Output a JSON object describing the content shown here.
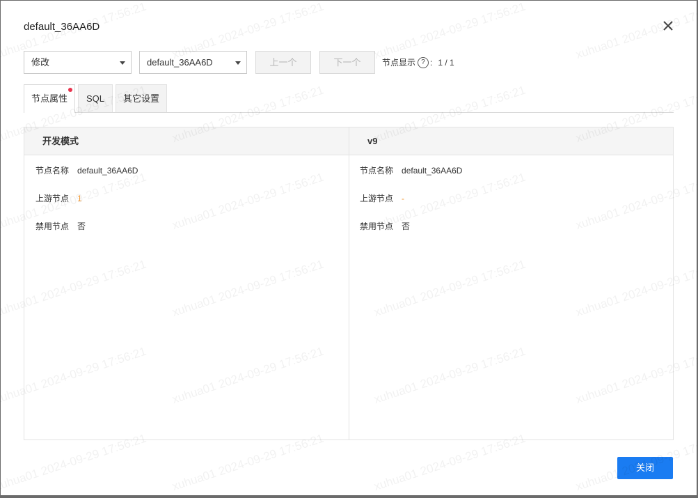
{
  "dialog": {
    "title": "default_36AA6D",
    "close_icon": "close-icon"
  },
  "toolbar": {
    "change_type_select": "修改",
    "node_select": "default_36AA6D",
    "prev_button": "上一个",
    "next_button": "下一个",
    "node_display_label": "节点显示",
    "help_icon": "question-circle-icon",
    "help_glyph": "?",
    "colon": ":",
    "node_count": "1 / 1"
  },
  "tabs": [
    {
      "label": "节点属性",
      "active": true,
      "has_dot": true
    },
    {
      "label": "SQL",
      "active": false
    },
    {
      "label": "其它设置",
      "active": false
    }
  ],
  "compare": {
    "left": {
      "header": "开发模式",
      "rows": [
        {
          "label": "节点名称",
          "value": "default_36AA6D"
        },
        {
          "label": "上游节点",
          "value": "1"
        },
        {
          "label": "禁用节点",
          "value": "否"
        }
      ]
    },
    "right": {
      "header": "v9",
      "rows": [
        {
          "label": "节点名称",
          "value": "default_36AA6D"
        },
        {
          "label": "上游节点",
          "value": "-"
        },
        {
          "label": "禁用节点",
          "value": "否"
        }
      ]
    }
  },
  "footer": {
    "close_button": "关闭"
  },
  "watermark": {
    "text": "xuhua01 2024-09-29 17:56:21"
  },
  "colors": {
    "primary": "#1a7cf2",
    "highlight": "#f29b38",
    "dot": "#e8344e"
  }
}
